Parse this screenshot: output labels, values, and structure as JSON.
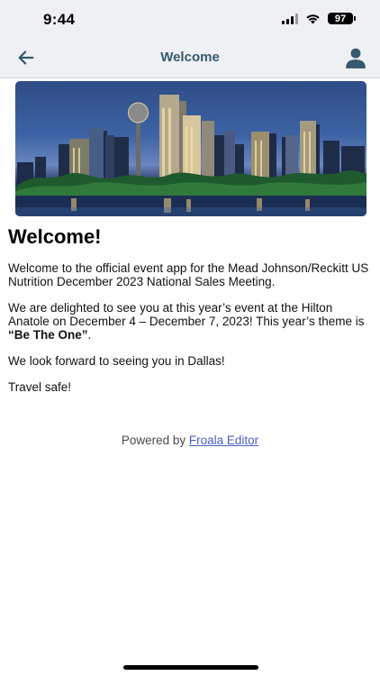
{
  "status_bar": {
    "time": "9:44",
    "battery": "97"
  },
  "nav": {
    "title": "Welcome",
    "back_icon": "arrow-left-icon",
    "user_icon": "person-icon"
  },
  "hero_image": {
    "description_icon": "city-skyline-image"
  },
  "content": {
    "heading": "Welcome!",
    "para1": "Welcome to the official event app for the Mead Johnson/Reckitt US Nutrition December 2023 National Sales Meeting.",
    "para2_pre": "We are delighted to see you at this year’s event at the Hilton Anatole on December 4 – December 7, 2023! This year’s theme is ",
    "para2_bold": "“Be The One”",
    "para2_post": ".",
    "para3": "We look forward to seeing you in Dallas!",
    "para4": "Travel safe!"
  },
  "footer": {
    "powered_prefix": "Powered by ",
    "powered_link": "Froala Editor"
  },
  "colors": {
    "nav_bg": "#eef0f3",
    "nav_title": "#37596f",
    "link": "#4a5fc1"
  }
}
